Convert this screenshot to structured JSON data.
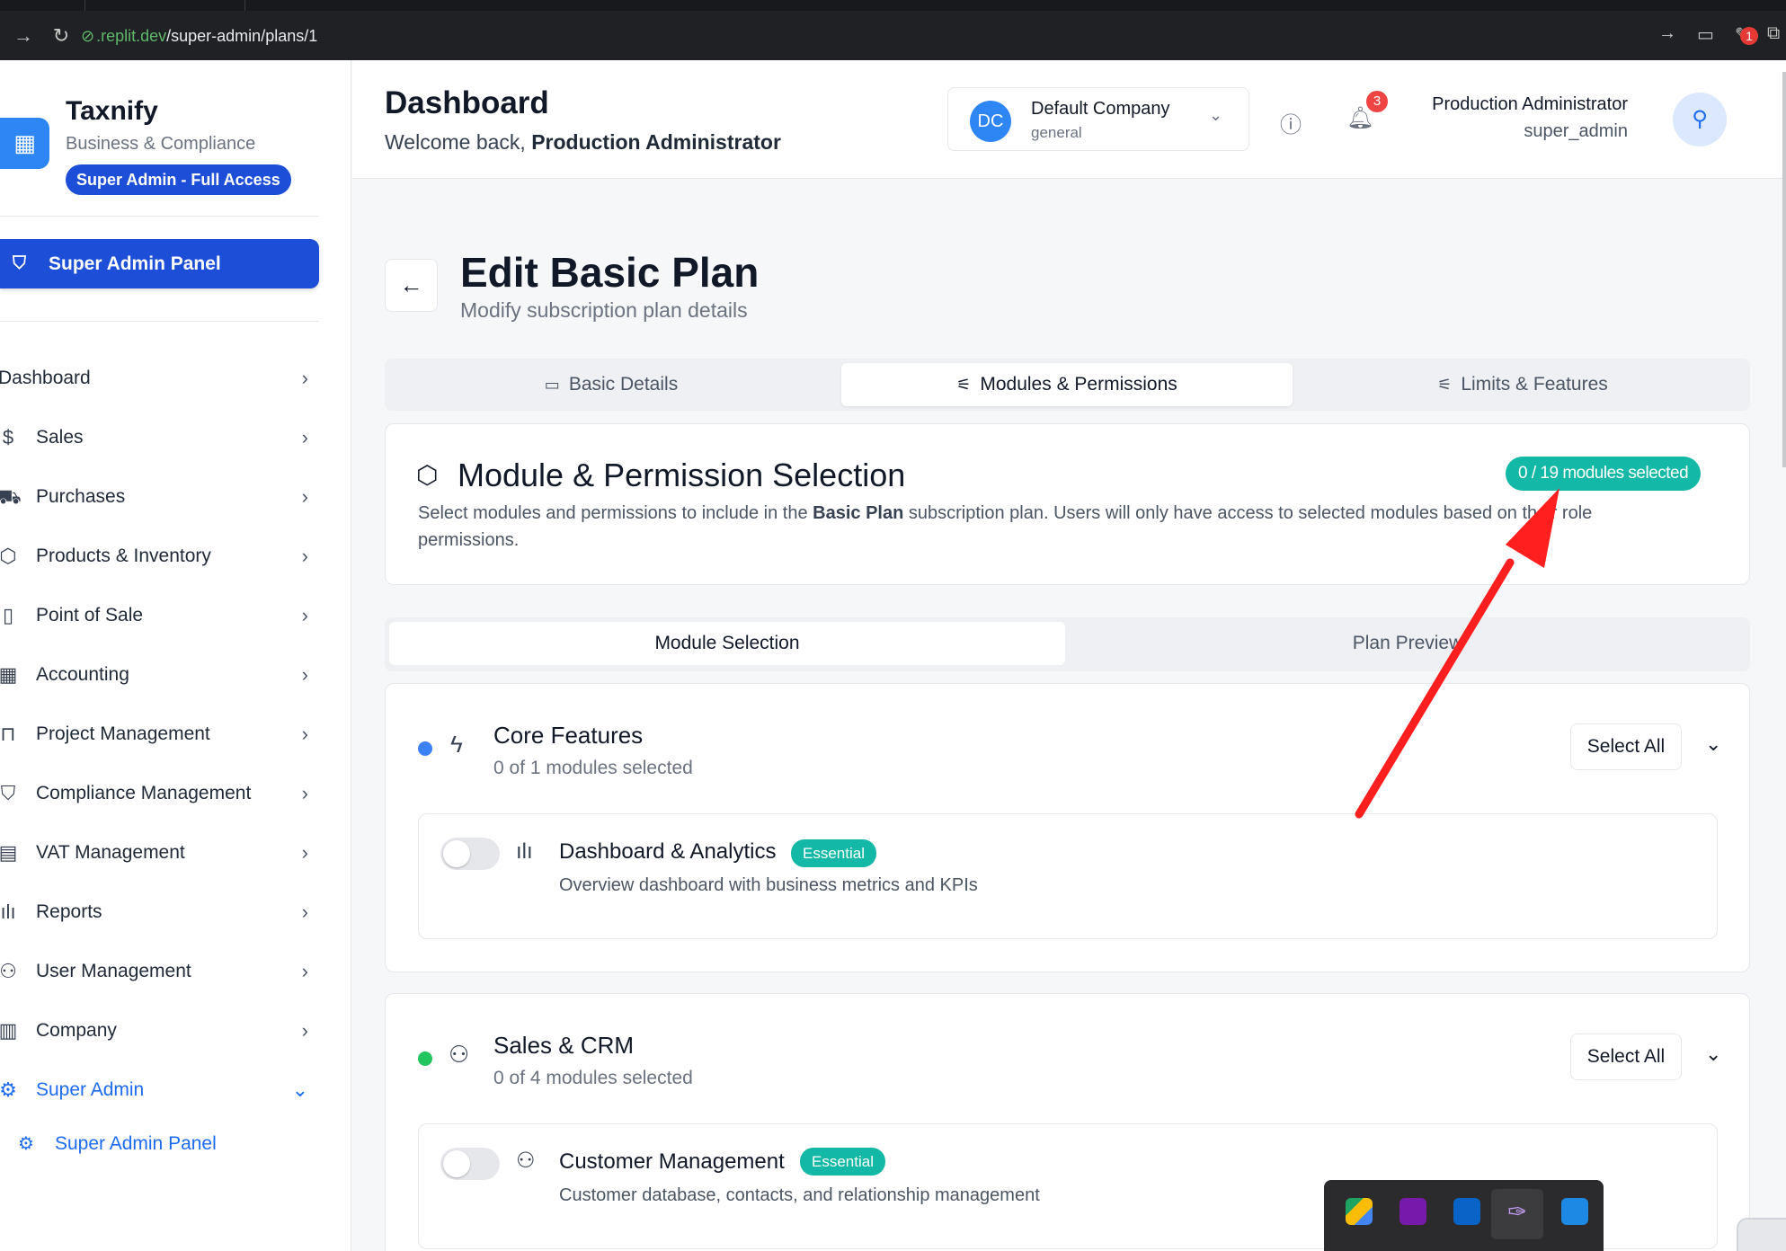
{
  "browser": {
    "url_domain": ".replit.dev",
    "url_path": "/super-admin/plans/1",
    "extension_badge": "1"
  },
  "sidebar": {
    "brand_name": "Taxnify",
    "brand_sub": "Business & Compliance",
    "access_badge": "Super Admin - Full Access",
    "panel_button": "Super Admin Panel",
    "items": [
      {
        "label": "Dashboard",
        "icon": "home-icon"
      },
      {
        "label": "Sales",
        "icon": "dollar-icon"
      },
      {
        "label": "Purchases",
        "icon": "truck-icon"
      },
      {
        "label": "Products & Inventory",
        "icon": "package-icon"
      },
      {
        "label": "Point of Sale",
        "icon": "tablet-icon"
      },
      {
        "label": "Accounting",
        "icon": "calculator-icon"
      },
      {
        "label": "Project Management",
        "icon": "briefcase-icon"
      },
      {
        "label": "Compliance Management",
        "icon": "shield-icon"
      },
      {
        "label": "VAT Management",
        "icon": "receipt-icon"
      },
      {
        "label": "Reports",
        "icon": "bar-chart-icon"
      },
      {
        "label": "User Management",
        "icon": "user-cog-icon"
      },
      {
        "label": "Company",
        "icon": "building-icon"
      },
      {
        "label": "Super Admin",
        "icon": "gear-icon"
      }
    ],
    "sub_item": "Super Admin Panel"
  },
  "header": {
    "title": "Dashboard",
    "welcome_prefix": "Welcome back, ",
    "welcome_name": "Production Administrator",
    "company_initials": "DC",
    "company_name": "Default Company",
    "company_sub": "general",
    "notification_count": "3",
    "user_name": "Production Administrator",
    "user_role": "super_admin"
  },
  "page": {
    "title": "Edit Basic Plan",
    "subtitle": "Modify subscription plan details",
    "tabs": [
      "Basic Details",
      "Modules & Permissions",
      "Limits & Features"
    ],
    "active_tab": 1
  },
  "selection": {
    "title": "Module & Permission Selection",
    "count_pill": "0 / 19 modules selected",
    "desc_part1": "Select modules and permissions to include in the ",
    "desc_bold": "Basic Plan",
    "desc_part2": " subscription plan. Users will only have access to selected modules based on their role permissions."
  },
  "subtabs": [
    "Module Selection",
    "Plan Preview"
  ],
  "groups": [
    {
      "title": "Core Features",
      "sub": "0 of 1 modules selected",
      "dot_color": "#3b82f6",
      "icon": "zap-icon",
      "select_all": "Select All",
      "module": {
        "title": "Dashboard & Analytics",
        "badge": "Essential",
        "desc": "Overview dashboard with business metrics and KPIs",
        "icon": "bar-chart-icon",
        "enabled": false
      }
    },
    {
      "title": "Sales & CRM",
      "sub": "0 of 4 modules selected",
      "dot_color": "#22c55e",
      "icon": "users-icon",
      "select_all": "Select All",
      "module": {
        "title": "Customer Management",
        "badge": "Essential",
        "desc": "Customer database, contacts, and relationship management",
        "icon": "users-icon",
        "enabled": false
      }
    }
  ],
  "annotation": {
    "color": "#ff1f1f"
  }
}
